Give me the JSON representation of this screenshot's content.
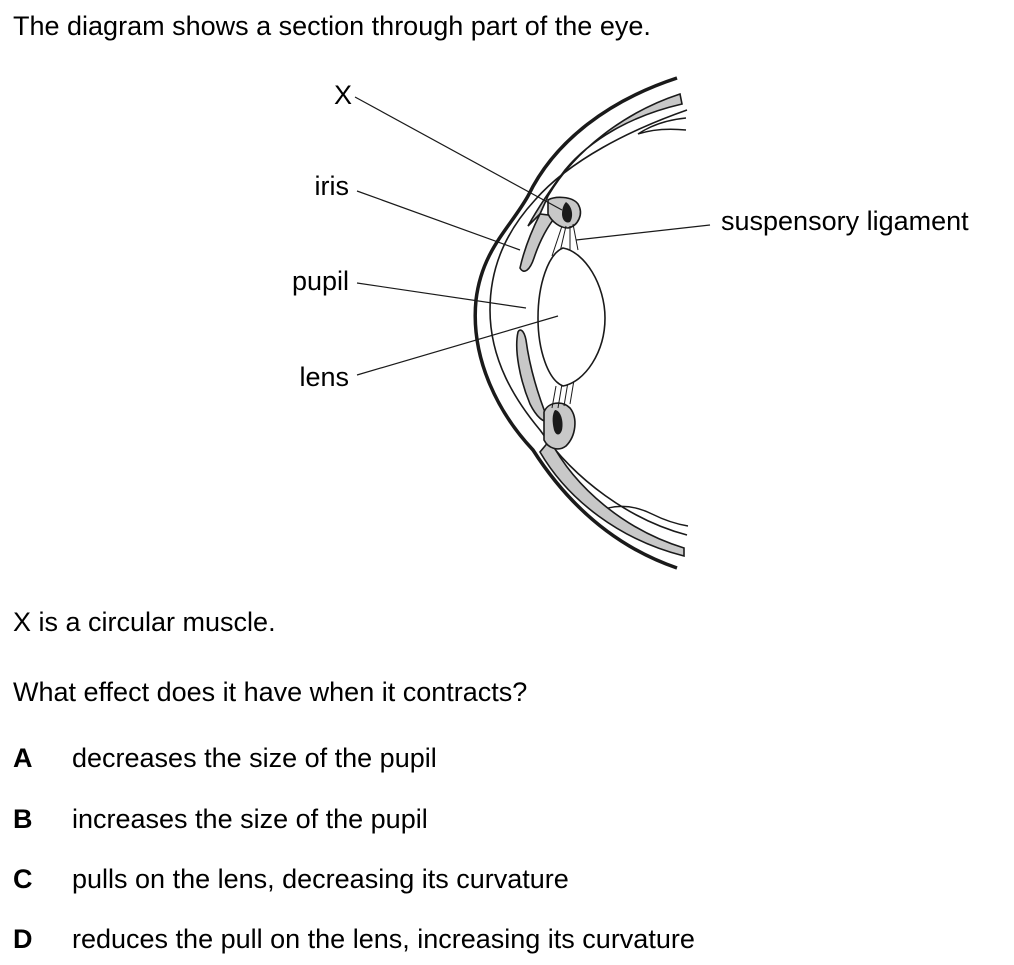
{
  "question": {
    "intro": "The diagram shows a section through part of the eye.",
    "statement": "X is a circular muscle.",
    "prompt": "What effect does it have when it contracts?"
  },
  "diagram": {
    "labels": {
      "x": "X",
      "iris": "iris",
      "pupil": "pupil",
      "lens": "lens",
      "suspensory_ligament": "suspensory ligament"
    },
    "colors": {
      "outline": "#1a1a1a",
      "tissue": "#c8c8c8",
      "muscle": "#1a1a1a"
    }
  },
  "options": [
    {
      "letter": "A",
      "text": "decreases the size of the pupil"
    },
    {
      "letter": "B",
      "text": "increases the size of the pupil"
    },
    {
      "letter": "C",
      "text": "pulls on the lens, decreasing its curvature"
    },
    {
      "letter": "D",
      "text": "reduces the pull on the lens, increasing its curvature"
    }
  ]
}
